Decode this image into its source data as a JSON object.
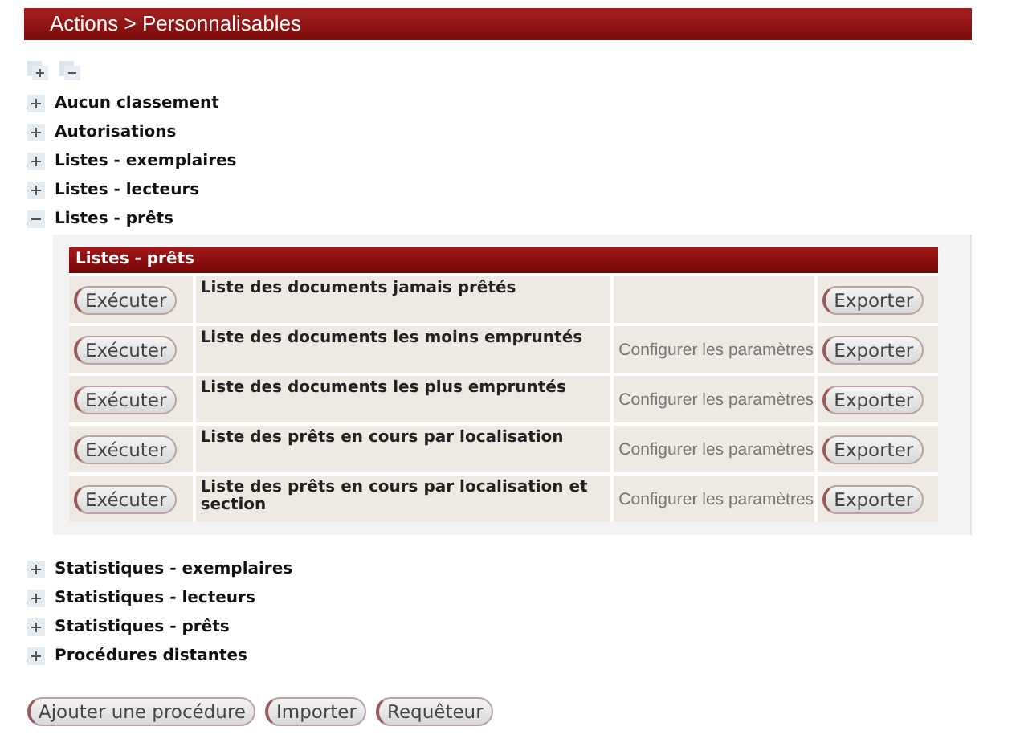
{
  "header": {
    "title": "Actions > Personnalisables"
  },
  "groups": [
    {
      "label": "Aucun classement",
      "expanded": false
    },
    {
      "label": "Autorisations",
      "expanded": false
    },
    {
      "label": "Listes - exemplaires",
      "expanded": false
    },
    {
      "label": "Listes - lecteurs",
      "expanded": false
    },
    {
      "label": "Listes - prêts",
      "expanded": true,
      "panel_title": "Listes - prêts",
      "procedures": [
        {
          "execute": "Exécuter",
          "name": "Liste des documents jamais prêtés",
          "export": "Exporter"
        },
        {
          "execute": "Exécuter",
          "name": "Liste des documents les moins empruntés",
          "configure": "Configurer les paramètres",
          "export": "Exporter"
        },
        {
          "execute": "Exécuter",
          "name": "Liste des documents les plus empruntés",
          "configure": "Configurer les paramètres",
          "export": "Exporter"
        },
        {
          "execute": "Exécuter",
          "name": "Liste des prêts en cours par localisation",
          "configure": "Configurer les paramètres",
          "export": "Exporter"
        },
        {
          "execute": "Exécuter",
          "name": "Liste des prêts en cours par localisation et section",
          "configure": "Configurer les paramètres",
          "export": "Exporter"
        }
      ]
    },
    {
      "label": "Statistiques - exemplaires",
      "expanded": false
    },
    {
      "label": "Statistiques - lecteurs",
      "expanded": false
    },
    {
      "label": "Statistiques - prêts",
      "expanded": false
    },
    {
      "label": "Procédures distantes",
      "expanded": false
    }
  ],
  "buttons": [
    "Ajouter une procédure",
    "Importer",
    "Requêteur"
  ]
}
